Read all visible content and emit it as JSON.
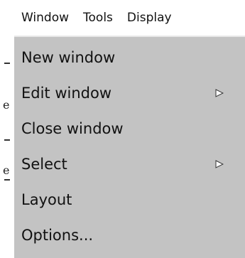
{
  "menubar": {
    "items": [
      {
        "label": "Window"
      },
      {
        "label": "Tools"
      },
      {
        "label": "Display"
      }
    ]
  },
  "dropdown": {
    "items": [
      {
        "label": "New window",
        "has_submenu": false
      },
      {
        "label": "Edit window",
        "has_submenu": true,
        "icon": "chevron-right-icon"
      },
      {
        "label": "Close window",
        "has_submenu": false
      },
      {
        "label": "Select",
        "has_submenu": true,
        "icon": "chevron-right-icon"
      },
      {
        "label": "Layout",
        "has_submenu": false
      },
      {
        "label": "Options...",
        "has_submenu": false
      }
    ]
  },
  "background_text": {
    "chars": [
      "e",
      "e"
    ]
  },
  "colors": {
    "menu_background": "#c3c3c3",
    "menubar_background": "#ffffff",
    "text": "#111111"
  }
}
